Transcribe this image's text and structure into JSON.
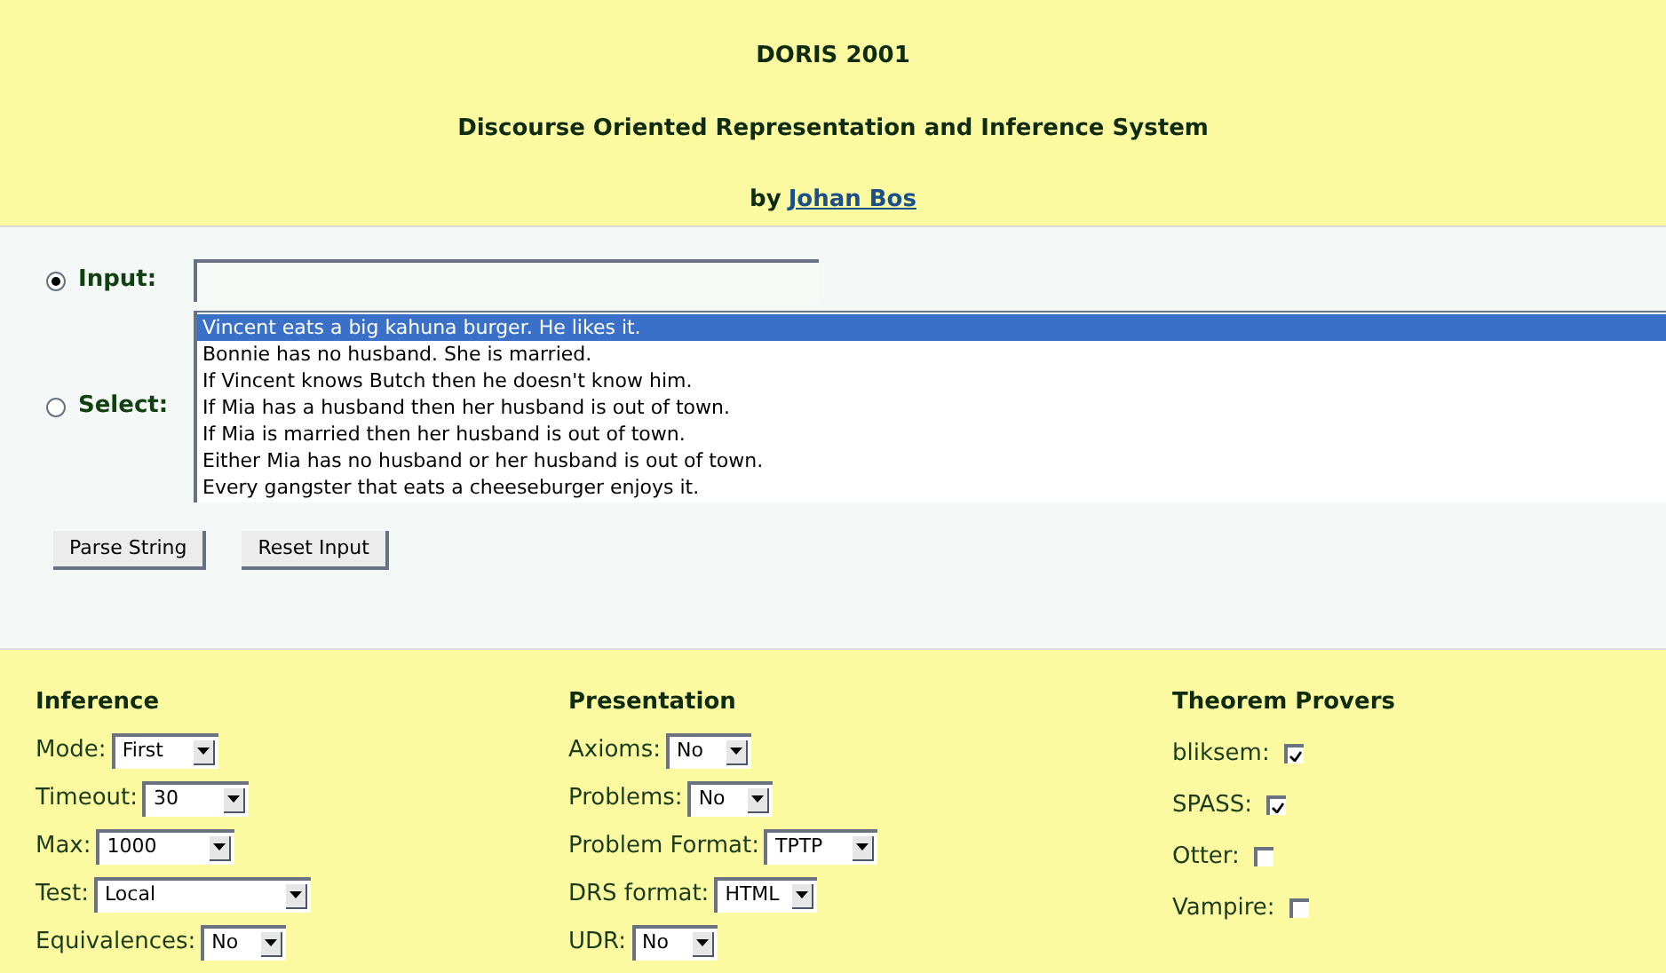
{
  "header": {
    "title": "DORIS 2001",
    "subtitle": "Discourse Oriented Representation and Inference System",
    "byline": "by",
    "author": "Johan Bos"
  },
  "input": {
    "label": "Input:",
    "selected": true
  },
  "select": {
    "label": "Select:",
    "selected": false,
    "options": [
      {
        "text": "Vincent eats a big kahuna burger. He likes it.",
        "selected": true
      },
      {
        "text": "Bonnie has no husband. She is married.",
        "selected": false
      },
      {
        "text": "If Vincent knows Butch then he doesn't know him.",
        "selected": false
      },
      {
        "text": "If Mia has a husband then her husband is out of town.",
        "selected": false
      },
      {
        "text": "If Mia is married then her husband is out of town.",
        "selected": false
      },
      {
        "text": "Either Mia has no husband or her husband is out of town.",
        "selected": false
      },
      {
        "text": "Every gangster that eats a cheeseburger enjoys it.",
        "selected": false
      }
    ]
  },
  "buttons": [
    "Parse String",
    "Reset Input"
  ],
  "sections": [
    {
      "title": "Inference",
      "fields": [
        {
          "kind": "select",
          "label": "Mode:",
          "value": "First"
        },
        {
          "kind": "select",
          "label": "Timeout:",
          "value": "30"
        },
        {
          "kind": "select",
          "label": "Max:",
          "value": "1000"
        },
        {
          "kind": "select",
          "label": "Test:",
          "value": "Local"
        },
        {
          "kind": "select",
          "label": "Equivalences:",
          "value": "No"
        }
      ]
    },
    {
      "title": "Presentation",
      "fields": [
        {
          "kind": "select",
          "label": "Axioms:",
          "value": "No"
        },
        {
          "kind": "select",
          "label": "Problems:",
          "value": "No"
        },
        {
          "kind": "select",
          "label": "Problem Format:",
          "value": "TPTP"
        },
        {
          "kind": "select",
          "label": "DRS format:",
          "value": "HTML"
        },
        {
          "kind": "select",
          "label": "UDR:",
          "value": "No"
        }
      ]
    },
    {
      "title": "Theorem Provers",
      "fields": [
        {
          "kind": "checkbox",
          "label": "bliksem:",
          "checked": true
        },
        {
          "kind": "checkbox",
          "label": "SPASS:",
          "checked": true
        },
        {
          "kind": "checkbox",
          "label": "Otter:",
          "checked": false
        },
        {
          "kind": "checkbox",
          "label": "Vampire:",
          "checked": false
        }
      ]
    }
  ]
}
